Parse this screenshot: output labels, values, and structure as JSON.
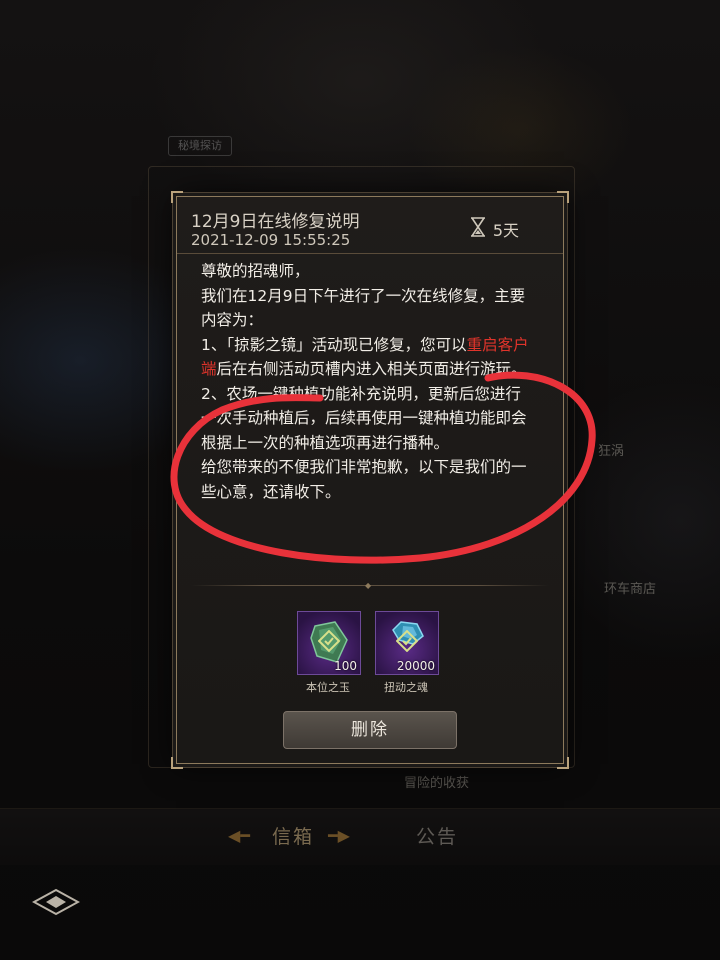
{
  "background": {
    "ghost_tag": "秘境探访",
    "ghost_right_labels": [
      "狂涡",
      "环车商店"
    ],
    "ghost_bottom_label": "冒险的收获"
  },
  "mail": {
    "title": "12月9日在线修复说明",
    "timestamp": "2021-12-09 15:55:25",
    "expire": "5天",
    "expire_icon": "hourglass-icon",
    "body": {
      "greeting": "尊敬的招魂师，",
      "intro": "我们在12月9日下午进行了一次在线修复，主要内容为：",
      "item1_pre": "1、「掠影之镜」活动现已修复，您可以",
      "item1_highlight": "重启客户端",
      "item1_post": "后在右侧活动页槽内进入相关页面进行游玩。",
      "item2": "2、农场一键种植功能补充说明，更新后您进行一次手动种植后，后续再使用一键种植功能即会根据上一次的种植选项再进行播种。",
      "closing": "给您带来的不便我们非常抱歉，以下是我们的一些心意，还请收下。"
    },
    "rewards": [
      {
        "name": "本位之玉",
        "count": "100",
        "icon": "jade-gem-icon",
        "claimed": true
      },
      {
        "name": "扭动之魂",
        "count": "20000",
        "icon": "soul-crystal-icon",
        "claimed": true
      }
    ],
    "delete_label": "删除"
  },
  "tabs": [
    {
      "label": "信箱",
      "active": true
    },
    {
      "label": "公告",
      "active": false
    }
  ],
  "colors": {
    "accent_gold": "#8d7a5c",
    "highlight_red": "#e0342b",
    "annotation_red": "#e8323a",
    "reward_purple": "#5a2b86"
  }
}
